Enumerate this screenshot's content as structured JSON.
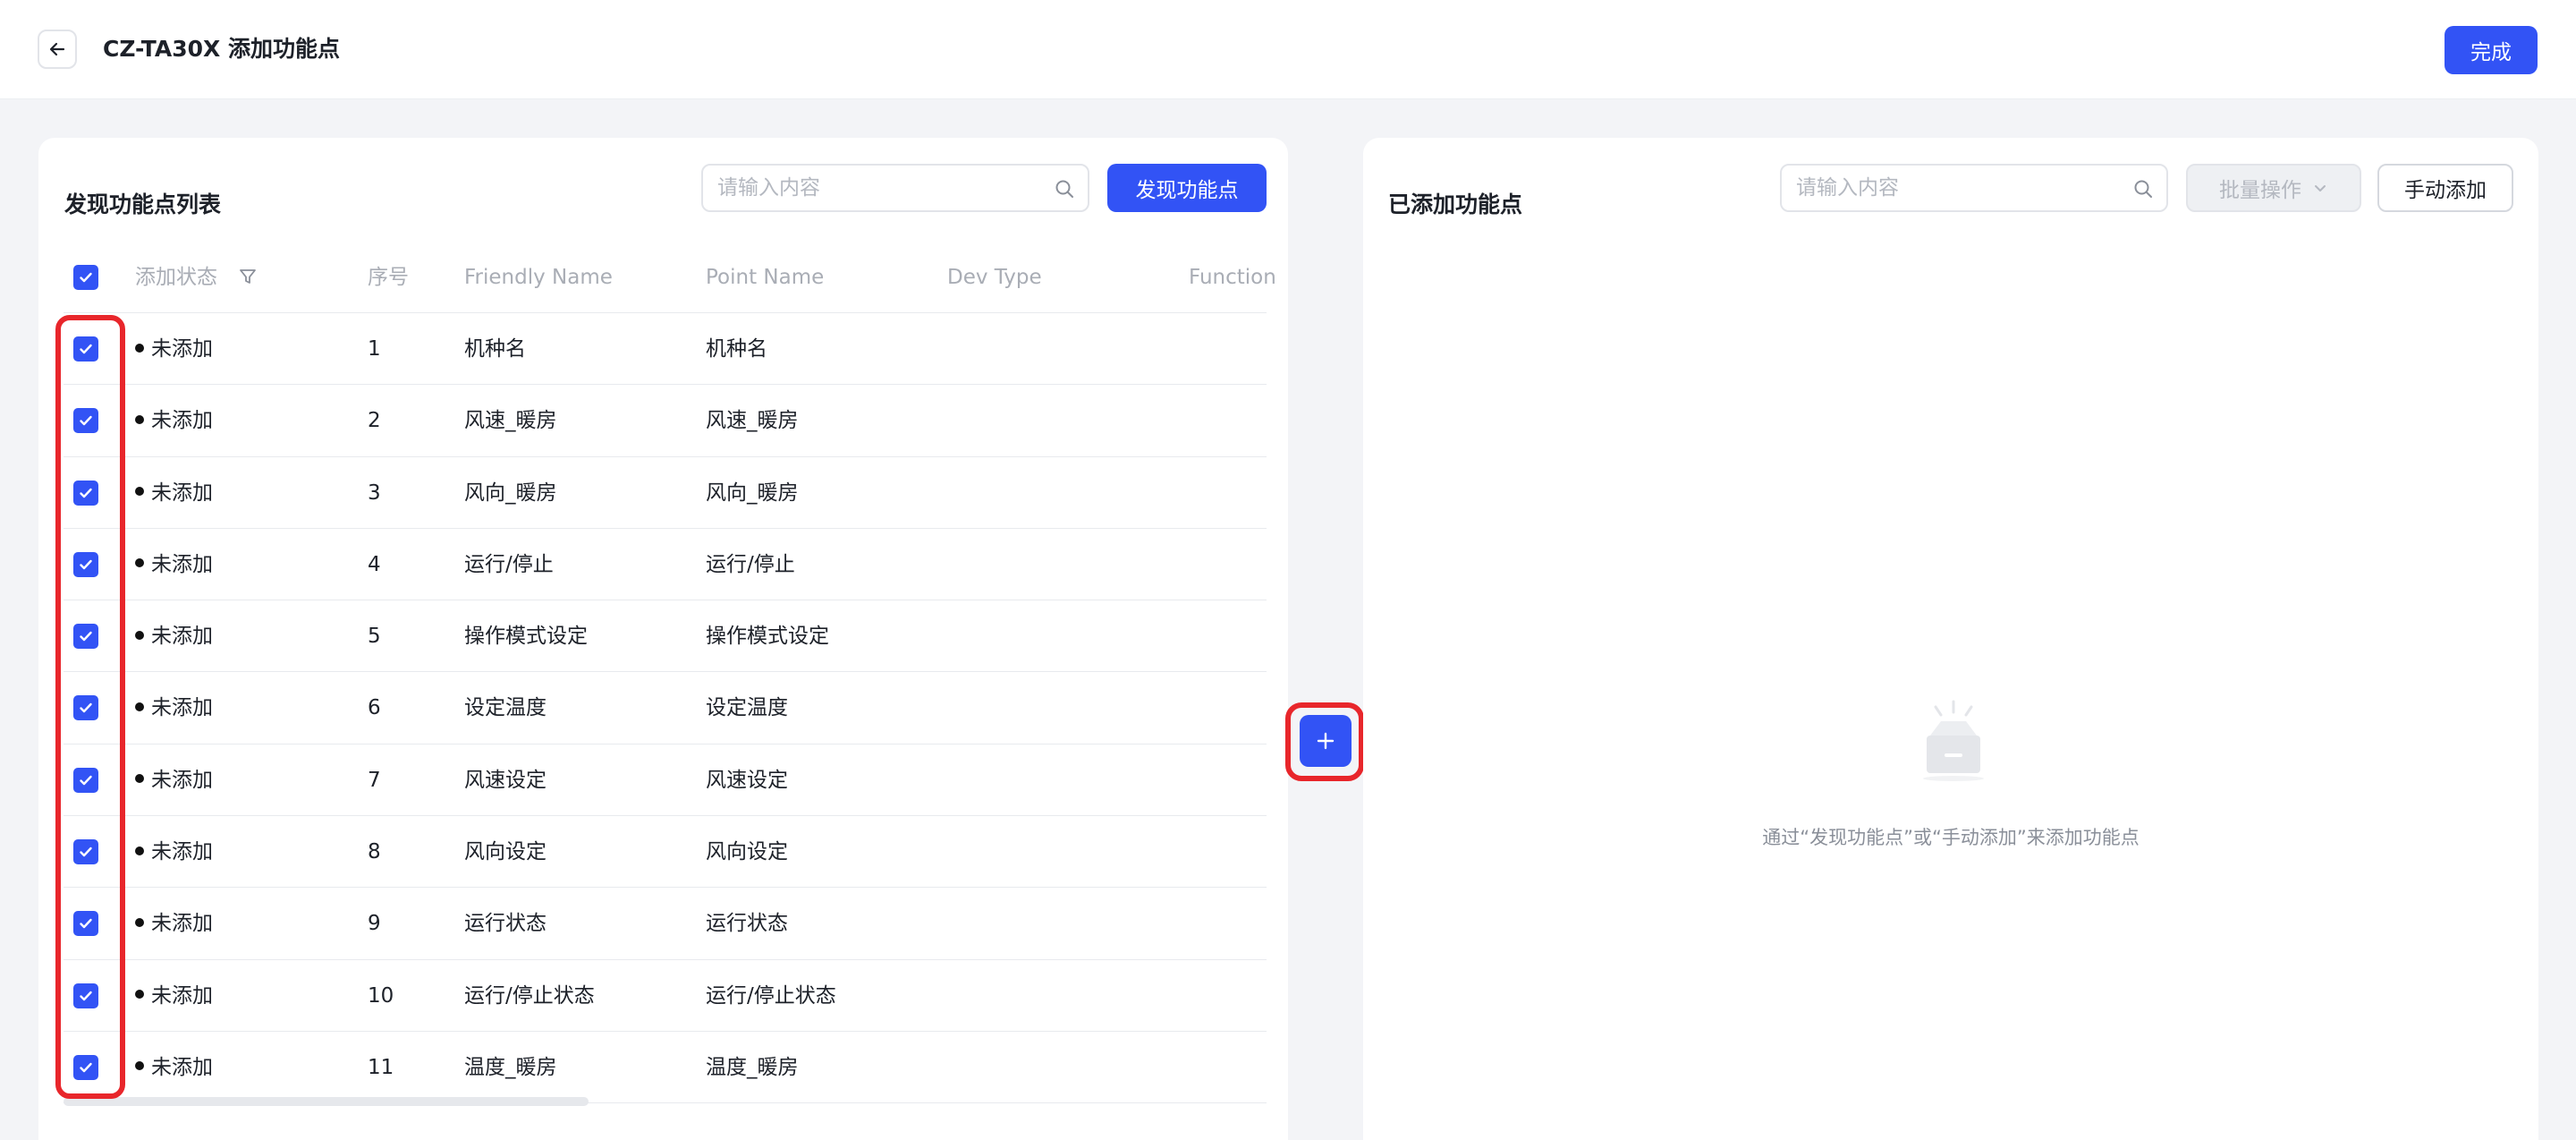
{
  "header": {
    "title": "CZ-TA30X 添加功能点",
    "done_label": "完成"
  },
  "left_panel": {
    "title": "发现功能点列表",
    "search_placeholder": "请输入内容",
    "discover_label": "发现功能点",
    "columns": {
      "status": "添加状态",
      "seq": "序号",
      "friendly": "Friendly Name",
      "point": "Point Name",
      "dev": "Dev Type",
      "func": "Function"
    },
    "rows": [
      {
        "status": "未添加",
        "seq": "1",
        "friendly": "机种名",
        "point": "机种名"
      },
      {
        "status": "未添加",
        "seq": "2",
        "friendly": "风速_暖房",
        "point": "风速_暖房"
      },
      {
        "status": "未添加",
        "seq": "3",
        "friendly": "风向_暖房",
        "point": "风向_暖房"
      },
      {
        "status": "未添加",
        "seq": "4",
        "friendly": "运行/停止",
        "point": "运行/停止"
      },
      {
        "status": "未添加",
        "seq": "5",
        "friendly": "操作模式设定",
        "point": "操作模式设定"
      },
      {
        "status": "未添加",
        "seq": "6",
        "friendly": "设定温度",
        "point": "设定温度"
      },
      {
        "status": "未添加",
        "seq": "7",
        "friendly": "风速设定",
        "point": "风速设定"
      },
      {
        "status": "未添加",
        "seq": "8",
        "friendly": "风向设定",
        "point": "风向设定"
      },
      {
        "status": "未添加",
        "seq": "9",
        "friendly": "运行状态",
        "point": "运行状态"
      },
      {
        "status": "未添加",
        "seq": "10",
        "friendly": "运行/停止状态",
        "point": "运行/停止状态"
      },
      {
        "status": "未添加",
        "seq": "11",
        "friendly": "温度_暖房",
        "point": "温度_暖房"
      }
    ]
  },
  "right_panel": {
    "title": "已添加功能点",
    "search_placeholder": "请输入内容",
    "batch_label": "批量操作",
    "manual_label": "手动添加",
    "empty_text": "通过“发现功能点”或“手动添加”来添加功能点"
  },
  "colors": {
    "accent": "#3253f5",
    "highlight": "#e8262b"
  }
}
